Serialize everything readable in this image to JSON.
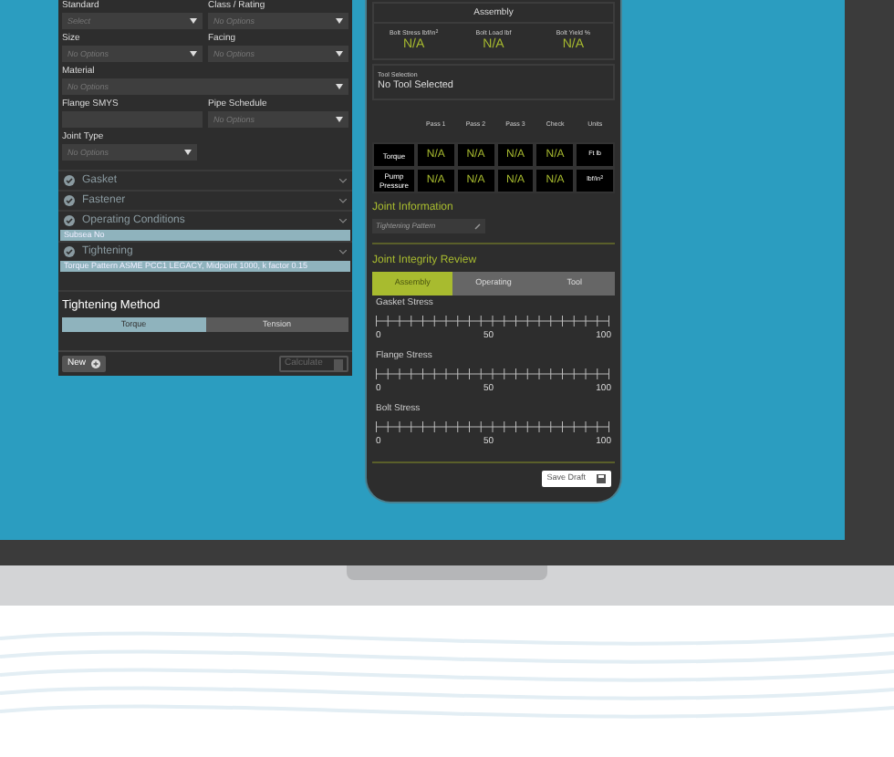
{
  "form": {
    "rows": [
      {
        "kind": "pair",
        "fields": [
          {
            "label": "Standard",
            "placeholder": "Select"
          },
          {
            "label": "Class / Rating",
            "placeholder": "No Options"
          }
        ]
      },
      {
        "kind": "pair",
        "fields": [
          {
            "label": "Size",
            "placeholder": "No Options"
          },
          {
            "label": "Facing",
            "placeholder": "No Options"
          }
        ]
      },
      {
        "kind": "full",
        "fields": [
          {
            "label": "Material",
            "placeholder": "No Options"
          }
        ]
      },
      {
        "kind": "pair",
        "fields": [
          {
            "label": "Flange SMYS",
            "kind": "text"
          },
          {
            "label": "Pipe Schedule",
            "placeholder": "No Options"
          }
        ]
      },
      {
        "kind": "half",
        "fields": [
          {
            "label": "Joint Type",
            "placeholder": "No Options"
          }
        ]
      }
    ],
    "sections": [
      {
        "title": "Gasket"
      },
      {
        "title": "Fastener"
      },
      {
        "title": "Operating Conditions",
        "summary": "Subsea No"
      },
      {
        "title": "Tightening",
        "summary": "Torque Pattern ASME PCC1 LEGACY, Midpoint 1000, k factor 0.15"
      }
    ],
    "method": {
      "title": "Tightening Method",
      "options": [
        {
          "label": "Torque",
          "selected": true
        },
        {
          "label": "Tension",
          "selected": false
        }
      ]
    },
    "footer": {
      "new": "New",
      "calculate": "Calculate",
      "calculate_disabled": true
    }
  },
  "results": {
    "header": "Assembly",
    "stats": [
      {
        "label": "Bolt Stress lbf/in$^{2}$",
        "value": "N/A"
      },
      {
        "label": "Bolt Load lbf",
        "value": "N/A"
      },
      {
        "label": "Bolt Yield %",
        "value": "N/A"
      }
    ],
    "tool": {
      "label": "Tool Selection",
      "value": "No Tool Selected"
    },
    "table": {
      "columns": [
        "Pass 1",
        "Pass 2",
        "Pass 3",
        "Check",
        "Units"
      ],
      "rows": [
        {
          "name": "Torque",
          "cells": [
            "N/A",
            "N/A",
            "N/A",
            "N/A",
            "Ft lb"
          ]
        },
        {
          "name": "Pump Pressure",
          "cells": [
            "N/A",
            "N/A",
            "N/A",
            "N/A",
            "lbf/in$^{2}$"
          ]
        }
      ]
    },
    "joint_title": "Joint Information",
    "joint_placeholder": "Tightening Pattern",
    "review_title": "Joint Integrity Review",
    "tabs": [
      {
        "label": "Assembly",
        "selected": true
      },
      {
        "label": "Operating",
        "selected": false
      },
      {
        "label": "Tool",
        "selected": false
      }
    ],
    "scales": [
      {
        "label": "Gasket Stress",
        "ticks": [
          "0",
          "50",
          "100"
        ]
      },
      {
        "label": "Flange Stress",
        "ticks": [
          "0",
          "50",
          "100"
        ]
      },
      {
        "label": "Bolt Stress",
        "ticks": [
          "0",
          "50",
          "100"
        ]
      }
    ],
    "save": "Save Draft"
  }
}
